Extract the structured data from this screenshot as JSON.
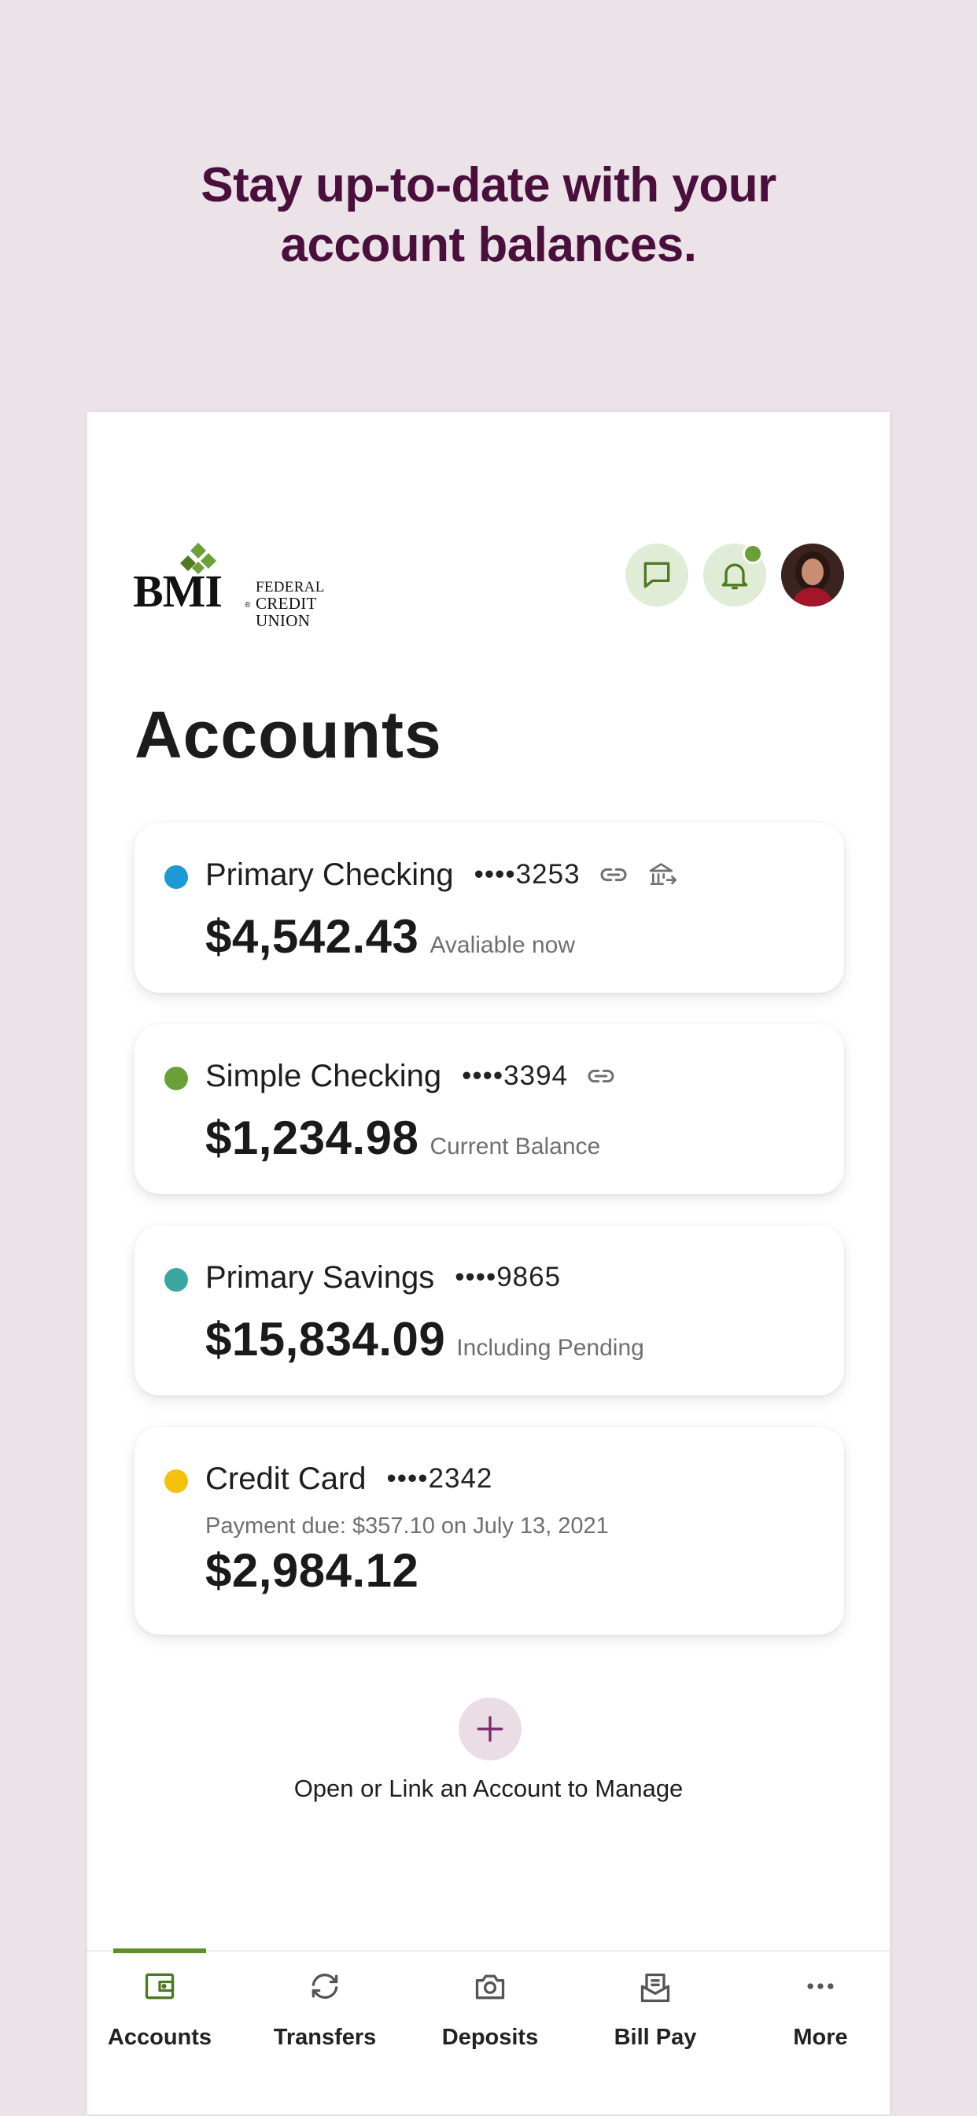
{
  "headline": {
    "line1": "Stay up-to-date with your",
    "line2": "account balances."
  },
  "brand": {
    "logo_text": "BMI",
    "registered": "®",
    "line1": "FEDERAL",
    "line2": "CREDIT UNION"
  },
  "header": {
    "chat_icon": "chat-bubble-icon",
    "bell_icon": "bell-icon",
    "has_notification": true
  },
  "page_title": "Accounts",
  "accounts": [
    {
      "name": "Primary Checking",
      "mask": "••••3253",
      "amount": "$4,542.43",
      "label": "Avaliable now",
      "dot_color": "#1b9ad6",
      "icons": [
        "link-icon",
        "bank-transfer-icon"
      ]
    },
    {
      "name": "Simple Checking",
      "mask": "••••3394",
      "amount": "$1,234.98",
      "label": "Current Balance",
      "dot_color": "#6aa036",
      "icons": [
        "link-icon"
      ]
    },
    {
      "name": "Primary Savings",
      "mask": "••••9865",
      "amount": "$15,834.09",
      "label": "Including Pending",
      "dot_color": "#3aa7a1",
      "icons": []
    },
    {
      "name": "Credit Card",
      "mask": "••••2342",
      "due": "Payment due: $357.10 on July 13, 2021",
      "amount": "$2,984.12",
      "dot_color": "#f4c20d",
      "icons": []
    }
  ],
  "add_account": {
    "label": "Open or Link an Account to Manage"
  },
  "tabs": [
    {
      "label": "Accounts",
      "icon": "wallet-icon",
      "active": true
    },
    {
      "label": "Transfers",
      "icon": "transfer-arrows-icon",
      "active": false
    },
    {
      "label": "Deposits",
      "icon": "camera-icon",
      "active": false
    },
    {
      "label": "Bill Pay",
      "icon": "bill-envelope-icon",
      "active": false
    },
    {
      "label": "More",
      "icon": "more-dots-icon",
      "active": false
    }
  ],
  "colors": {
    "background": "#ebe3e8",
    "headline": "#4a0f3c",
    "accent_green": "#5c8f2a",
    "icon_bg_green": "#e0ecd6",
    "add_bg": "#eadde6",
    "add_plus": "#7a2a68"
  }
}
